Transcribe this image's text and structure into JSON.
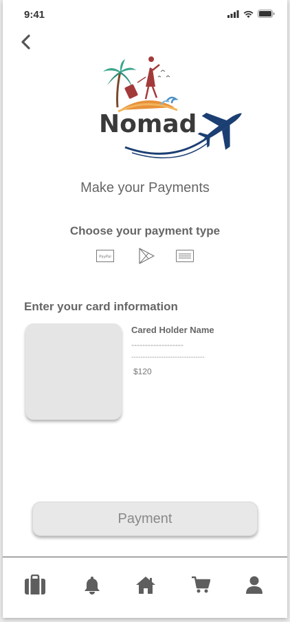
{
  "status_bar": {
    "time": "9:41",
    "icons": [
      "signal-icon",
      "wifi-icon",
      "battery-icon"
    ]
  },
  "header": {
    "back_icon": "chevron-left-icon"
  },
  "logo": {
    "text": "Nomad",
    "colors": {
      "text": "#3a3a3a",
      "plane": "#1c3f73",
      "palm": "#3aa58e",
      "sun": "#e8923b",
      "figure": "#a33a3a"
    }
  },
  "page": {
    "title": "Make your Payments",
    "payment_type_heading": "Choose your payment type",
    "payment_options": [
      {
        "name": "paypal",
        "label": "PayPal",
        "icon": "paypal-icon"
      },
      {
        "name": "google-play",
        "label": "",
        "icon": "play-store-icon"
      },
      {
        "name": "card",
        "label": "",
        "icon": "card-icon"
      }
    ],
    "card_heading": "Enter your card information",
    "card_holder_label": "Cared Holder Name",
    "card_number_placeholder": "-------------------",
    "card_extra_placeholder": "--------------------------------",
    "amount": "$120"
  },
  "payment_button_label": "Payment",
  "bottom_nav": [
    {
      "name": "luggage",
      "icon": "briefcase-icon"
    },
    {
      "name": "notifications",
      "icon": "bell-icon"
    },
    {
      "name": "home",
      "icon": "home-icon"
    },
    {
      "name": "cart",
      "icon": "cart-icon"
    },
    {
      "name": "profile",
      "icon": "user-icon"
    }
  ],
  "colors": {
    "icon_gray": "#5e5e5e",
    "button_bg": "#e8e8e8",
    "card_bg": "#e5e5e5"
  }
}
